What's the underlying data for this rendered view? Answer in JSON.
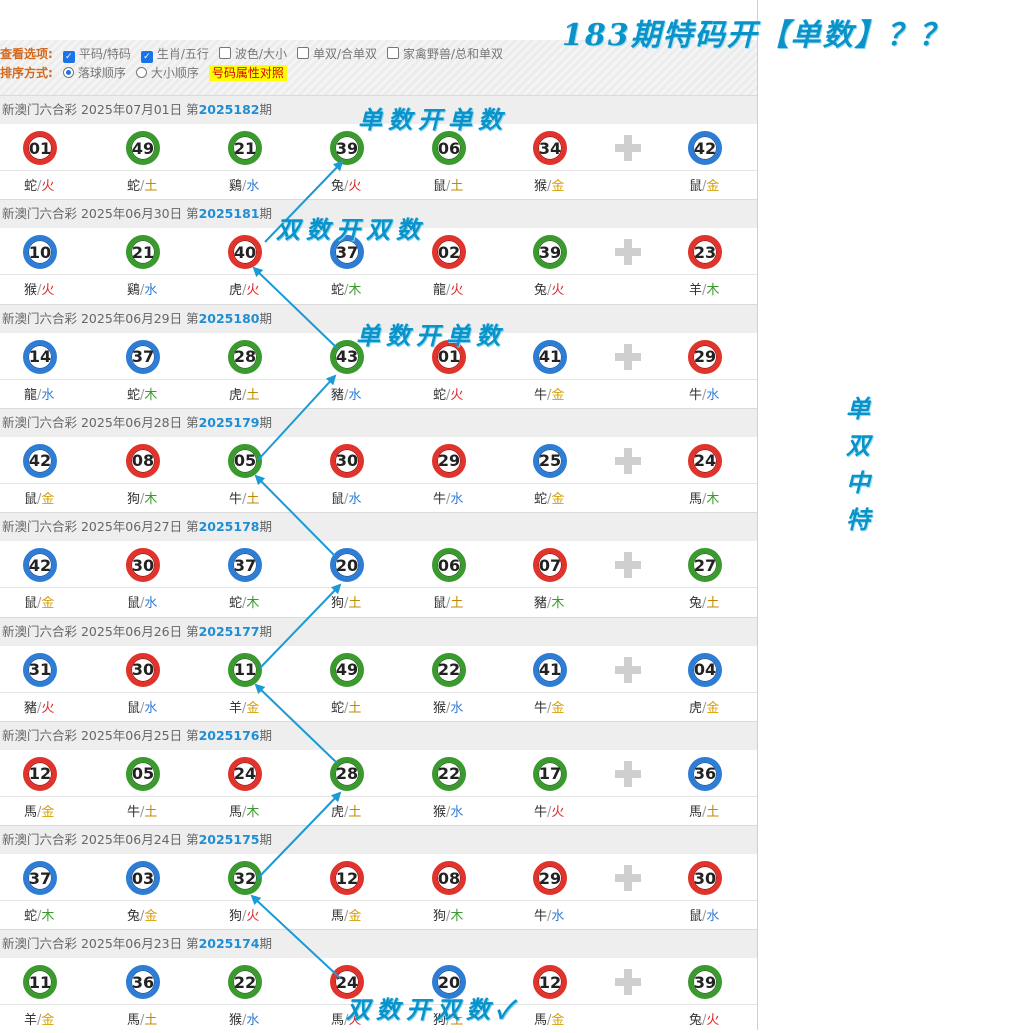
{
  "title": "183期特码开【单数】？？",
  "side_text": [
    "单",
    "双",
    "中",
    "特"
  ],
  "options": {
    "label1": "查看选项:",
    "label2": "排序方式:",
    "view": [
      {
        "label": "平码/特码",
        "checked": true
      },
      {
        "label": "生肖/五行",
        "checked": true
      },
      {
        "label": "波色/大小",
        "checked": false
      },
      {
        "label": "单双/合单双",
        "checked": false
      },
      {
        "label": "家禽野兽/总和单双",
        "checked": false
      }
    ],
    "sort": [
      {
        "label": "落球顺序",
        "checked": true
      },
      {
        "label": "大小顺序",
        "checked": false
      }
    ],
    "compare_label": "号码属性对照"
  },
  "colors": {
    "red": "#e0332b",
    "blue": "#2e7dd4",
    "green": "#3a9a2e",
    "annotation": "#0a93c9",
    "issue": "#1e8fd6"
  },
  "plus_icon": "plus-icon",
  "draws": [
    {
      "prefix": "新澳门六合彩 2025年07月01日 第",
      "issue": "2025182",
      "suffix": "期",
      "balls": [
        {
          "n": "01",
          "c": "red",
          "z": "蛇",
          "e": "火",
          "ec": "huo"
        },
        {
          "n": "49",
          "c": "green",
          "z": "蛇",
          "e": "土",
          "ec": "tu"
        },
        {
          "n": "21",
          "c": "green",
          "z": "鷄",
          "e": "水",
          "ec": "shui"
        },
        {
          "n": "39",
          "c": "green",
          "z": "兔",
          "e": "火",
          "ec": "huo"
        },
        {
          "n": "06",
          "c": "green",
          "z": "鼠",
          "e": "土",
          "ec": "tu"
        },
        {
          "n": "34",
          "c": "red",
          "z": "猴",
          "e": "金",
          "ec": "jin"
        }
      ],
      "special": {
        "n": "42",
        "c": "blue",
        "z": "鼠",
        "e": "金",
        "ec": "jin"
      }
    },
    {
      "prefix": "新澳门六合彩 2025年06月30日 第",
      "issue": "2025181",
      "suffix": "期",
      "balls": [
        {
          "n": "10",
          "c": "blue",
          "z": "猴",
          "e": "火",
          "ec": "huo"
        },
        {
          "n": "21",
          "c": "green",
          "z": "鷄",
          "e": "水",
          "ec": "shui"
        },
        {
          "n": "40",
          "c": "red",
          "z": "虎",
          "e": "火",
          "ec": "huo"
        },
        {
          "n": "37",
          "c": "blue",
          "z": "蛇",
          "e": "木",
          "ec": "mu"
        },
        {
          "n": "02",
          "c": "red",
          "z": "龍",
          "e": "火",
          "ec": "huo"
        },
        {
          "n": "39",
          "c": "green",
          "z": "兔",
          "e": "火",
          "ec": "huo"
        }
      ],
      "special": {
        "n": "23",
        "c": "red",
        "z": "羊",
        "e": "木",
        "ec": "mu"
      }
    },
    {
      "prefix": "新澳门六合彩 2025年06月29日 第",
      "issue": "2025180",
      "suffix": "期",
      "balls": [
        {
          "n": "14",
          "c": "blue",
          "z": "龍",
          "e": "水",
          "ec": "shui"
        },
        {
          "n": "37",
          "c": "blue",
          "z": "蛇",
          "e": "木",
          "ec": "mu"
        },
        {
          "n": "28",
          "c": "green",
          "z": "虎",
          "e": "土",
          "ec": "tu"
        },
        {
          "n": "43",
          "c": "green",
          "z": "豬",
          "e": "水",
          "ec": "shui"
        },
        {
          "n": "01",
          "c": "red",
          "z": "蛇",
          "e": "火",
          "ec": "huo"
        },
        {
          "n": "41",
          "c": "blue",
          "z": "牛",
          "e": "金",
          "ec": "jin"
        }
      ],
      "special": {
        "n": "29",
        "c": "red",
        "z": "牛",
        "e": "水",
        "ec": "shui"
      }
    },
    {
      "prefix": "新澳门六合彩 2025年06月28日 第",
      "issue": "2025179",
      "suffix": "期",
      "balls": [
        {
          "n": "42",
          "c": "blue",
          "z": "鼠",
          "e": "金",
          "ec": "jin"
        },
        {
          "n": "08",
          "c": "red",
          "z": "狗",
          "e": "木",
          "ec": "mu"
        },
        {
          "n": "05",
          "c": "green",
          "z": "牛",
          "e": "土",
          "ec": "tu"
        },
        {
          "n": "30",
          "c": "red",
          "z": "鼠",
          "e": "水",
          "ec": "shui"
        },
        {
          "n": "29",
          "c": "red",
          "z": "牛",
          "e": "水",
          "ec": "shui"
        },
        {
          "n": "25",
          "c": "blue",
          "z": "蛇",
          "e": "金",
          "ec": "jin"
        }
      ],
      "special": {
        "n": "24",
        "c": "red",
        "z": "馬",
        "e": "木",
        "ec": "mu"
      }
    },
    {
      "prefix": "新澳门六合彩 2025年06月27日 第",
      "issue": "2025178",
      "suffix": "期",
      "balls": [
        {
          "n": "42",
          "c": "blue",
          "z": "鼠",
          "e": "金",
          "ec": "jin"
        },
        {
          "n": "30",
          "c": "red",
          "z": "鼠",
          "e": "水",
          "ec": "shui"
        },
        {
          "n": "37",
          "c": "blue",
          "z": "蛇",
          "e": "木",
          "ec": "mu"
        },
        {
          "n": "20",
          "c": "blue",
          "z": "狗",
          "e": "土",
          "ec": "tu"
        },
        {
          "n": "06",
          "c": "green",
          "z": "鼠",
          "e": "土",
          "ec": "tu"
        },
        {
          "n": "07",
          "c": "red",
          "z": "豬",
          "e": "木",
          "ec": "mu"
        }
      ],
      "special": {
        "n": "27",
        "c": "green",
        "z": "兔",
        "e": "土",
        "ec": "tu"
      }
    },
    {
      "prefix": "新澳门六合彩 2025年06月26日 第",
      "issue": "2025177",
      "suffix": "期",
      "balls": [
        {
          "n": "31",
          "c": "blue",
          "z": "豬",
          "e": "火",
          "ec": "huo"
        },
        {
          "n": "30",
          "c": "red",
          "z": "鼠",
          "e": "水",
          "ec": "shui"
        },
        {
          "n": "11",
          "c": "green",
          "z": "羊",
          "e": "金",
          "ec": "jin"
        },
        {
          "n": "49",
          "c": "green",
          "z": "蛇",
          "e": "土",
          "ec": "tu"
        },
        {
          "n": "22",
          "c": "green",
          "z": "猴",
          "e": "水",
          "ec": "shui"
        },
        {
          "n": "41",
          "c": "blue",
          "z": "牛",
          "e": "金",
          "ec": "jin"
        }
      ],
      "special": {
        "n": "04",
        "c": "blue",
        "z": "虎",
        "e": "金",
        "ec": "jin"
      }
    },
    {
      "prefix": "新澳门六合彩 2025年06月25日 第",
      "issue": "2025176",
      "suffix": "期",
      "balls": [
        {
          "n": "12",
          "c": "red",
          "z": "馬",
          "e": "金",
          "ec": "jin"
        },
        {
          "n": "05",
          "c": "green",
          "z": "牛",
          "e": "土",
          "ec": "tu"
        },
        {
          "n": "24",
          "c": "red",
          "z": "馬",
          "e": "木",
          "ec": "mu"
        },
        {
          "n": "28",
          "c": "green",
          "z": "虎",
          "e": "土",
          "ec": "tu"
        },
        {
          "n": "22",
          "c": "green",
          "z": "猴",
          "e": "水",
          "ec": "shui"
        },
        {
          "n": "17",
          "c": "green",
          "z": "牛",
          "e": "火",
          "ec": "huo"
        }
      ],
      "special": {
        "n": "36",
        "c": "blue",
        "z": "馬",
        "e": "土",
        "ec": "tu"
      }
    },
    {
      "prefix": "新澳门六合彩 2025年06月24日 第",
      "issue": "2025175",
      "suffix": "期",
      "balls": [
        {
          "n": "37",
          "c": "blue",
          "z": "蛇",
          "e": "木",
          "ec": "mu"
        },
        {
          "n": "03",
          "c": "blue",
          "z": "兔",
          "e": "金",
          "ec": "jin"
        },
        {
          "n": "32",
          "c": "green",
          "z": "狗",
          "e": "火",
          "ec": "huo"
        },
        {
          "n": "12",
          "c": "red",
          "z": "馬",
          "e": "金",
          "ec": "jin"
        },
        {
          "n": "08",
          "c": "red",
          "z": "狗",
          "e": "木",
          "ec": "mu"
        },
        {
          "n": "29",
          "c": "red",
          "z": "牛",
          "e": "水",
          "ec": "shui"
        }
      ],
      "special": {
        "n": "30",
        "c": "red",
        "z": "鼠",
        "e": "水",
        "ec": "shui"
      }
    },
    {
      "prefix": "新澳门六合彩 2025年06月23日 第",
      "issue": "2025174",
      "suffix": "期",
      "balls": [
        {
          "n": "11",
          "c": "green",
          "z": "羊",
          "e": "金",
          "ec": "jin"
        },
        {
          "n": "36",
          "c": "blue",
          "z": "馬",
          "e": "土",
          "ec": "tu"
        },
        {
          "n": "22",
          "c": "green",
          "z": "猴",
          "e": "水",
          "ec": "shui"
        },
        {
          "n": "24",
          "c": "red",
          "z": "馬",
          "e": "火",
          "ec": "huo"
        },
        {
          "n": "20",
          "c": "blue",
          "z": "狗",
          "e": "土",
          "ec": "tu"
        },
        {
          "n": "12",
          "c": "red",
          "z": "馬",
          "e": "金",
          "ec": "jin"
        }
      ],
      "special": {
        "n": "39",
        "c": "green",
        "z": "兔",
        "e": "火",
        "ec": "huo"
      }
    }
  ],
  "annotations": [
    "单数开单数",
    "双数开双数",
    "单数开单数",
    "双数开双数✓"
  ]
}
